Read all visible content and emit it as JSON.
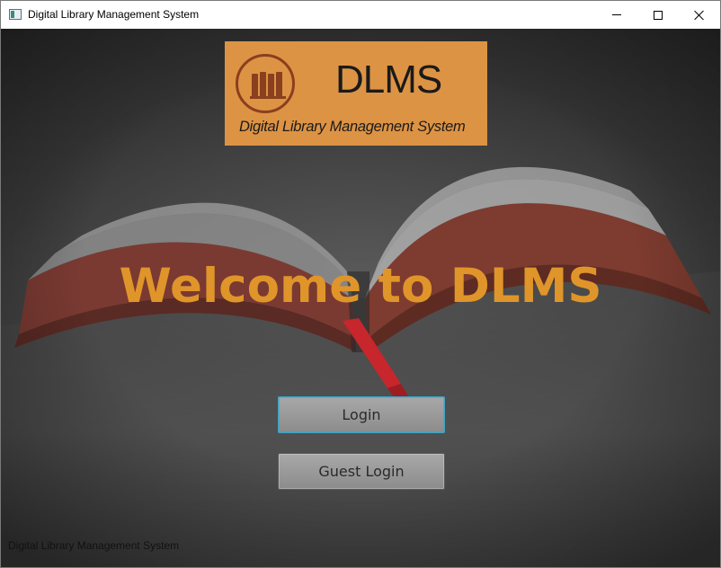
{
  "window": {
    "title": "Digital Library Management System"
  },
  "logo": {
    "title": "DLMS",
    "subtitle": "Digital Library Management System",
    "background_color": "#dd9344",
    "icon": "books-circle-icon"
  },
  "main": {
    "heading": "Welcome to DLMS",
    "heading_color": "#e0952a",
    "login_label": "Login",
    "guest_login_label": "Guest Login"
  },
  "footer": {
    "text": "Digital Library Management System"
  }
}
